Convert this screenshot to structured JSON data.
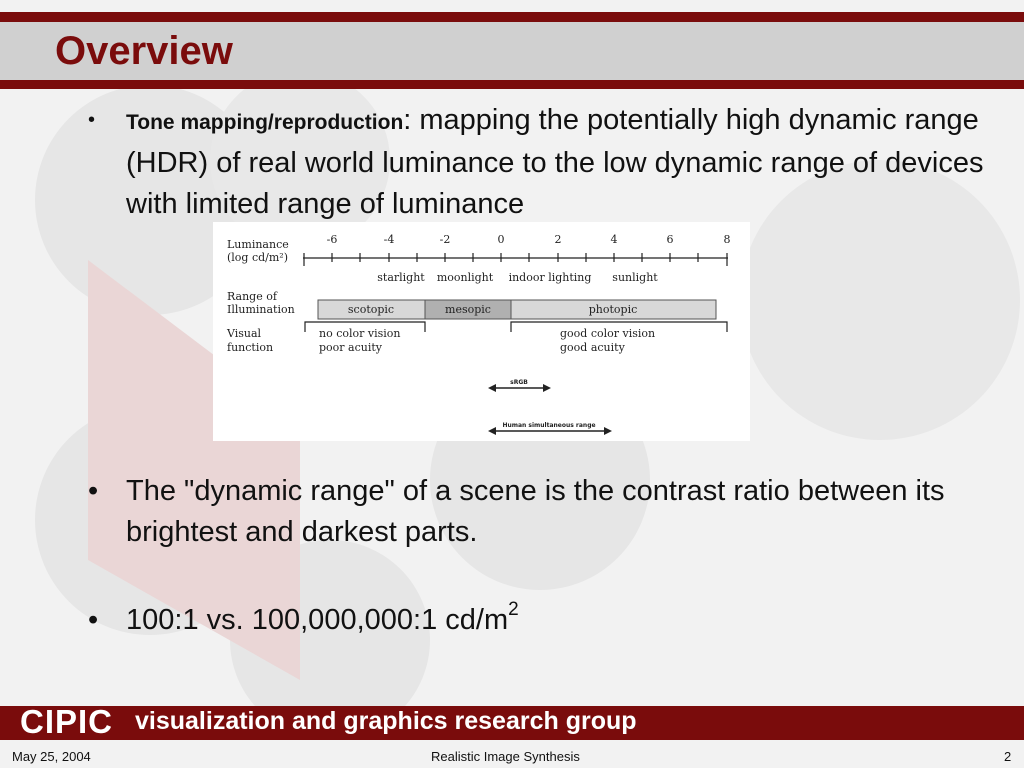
{
  "title": "Overview",
  "bullets": [
    {
      "term": "Tone mapping/reproduction",
      "text": ": mapping the potentially high dynamic range (HDR) of real world luminance to the low dynamic range of devices with limited range of luminance"
    },
    {
      "text": "The \"dynamic range\" of a scene is the contrast ratio between its brightest and darkest parts."
    },
    {
      "text": "100:1 vs. 100,000,000:1 cd/m",
      "sup": "2"
    }
  ],
  "bullet_char": "•",
  "figure": {
    "row_labels": {
      "luminance_1": "Luminance",
      "luminance_2": "(log cd/m²)",
      "range_1": "Range of",
      "range_2": "Illumination",
      "visual_1": "Visual",
      "visual_2": "function"
    },
    "ticks": [
      "-6",
      "-4",
      "-2",
      "0",
      "2",
      "4",
      "6",
      "8"
    ],
    "conditions": [
      "starlight",
      "moonlight",
      "indoor lighting",
      "sunlight"
    ],
    "ranges": [
      "scotopic",
      "mesopic",
      "photopic"
    ],
    "visual_left_1": "no color vision",
    "visual_left_2": "poor acuity",
    "visual_right_1": "good color vision",
    "visual_right_2": "good acuity",
    "srgb_label": "sRGB",
    "human_label": "Human simultaneous range"
  },
  "footer": {
    "logo": "CIPIC",
    "group": "visualization and graphics research group",
    "date": "May 25, 2004",
    "center": "Realistic Image Synthesis",
    "page": "2"
  },
  "colors": {
    "accent": "#7a0c0c",
    "title_band": "#d0d0d0",
    "background": "#f2f2f2"
  }
}
